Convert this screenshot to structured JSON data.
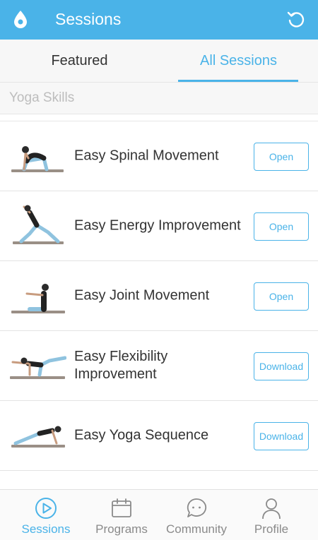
{
  "header": {
    "title": "Sessions",
    "logo_icon": "drop-logo-icon",
    "refresh_icon": "refresh-icon"
  },
  "tabs": [
    {
      "label": "Featured",
      "active": false
    },
    {
      "label": "All Sessions",
      "active": true
    }
  ],
  "section": {
    "label": "Yoga Skills"
  },
  "sessions": [
    {
      "title": "Easy Spinal Movement",
      "action": "Open",
      "thumbnail_icon": "yoga-cat-pose-icon"
    },
    {
      "title": "Easy Energy Improvement",
      "action": "Open",
      "thumbnail_icon": "yoga-lunge-pose-icon"
    },
    {
      "title": "Easy Joint Movement",
      "action": "Open",
      "thumbnail_icon": "yoga-seated-pose-icon"
    },
    {
      "title": "Easy Flexibility Improvement",
      "action": "Download",
      "thumbnail_icon": "yoga-bird-dog-pose-icon"
    },
    {
      "title": "Easy Yoga Sequence",
      "action": "Download",
      "thumbnail_icon": "yoga-plank-pose-icon"
    }
  ],
  "bottom_nav": [
    {
      "label": "Sessions",
      "icon": "play-circle-icon",
      "active": true
    },
    {
      "label": "Programs",
      "icon": "calendar-icon",
      "active": false
    },
    {
      "label": "Community",
      "icon": "chat-bubble-icon",
      "active": false
    },
    {
      "label": "Profile",
      "icon": "person-icon",
      "active": false
    }
  ],
  "colors": {
    "accent": "#4ab3e8",
    "text": "#333333",
    "muted": "#8a8a8a"
  }
}
